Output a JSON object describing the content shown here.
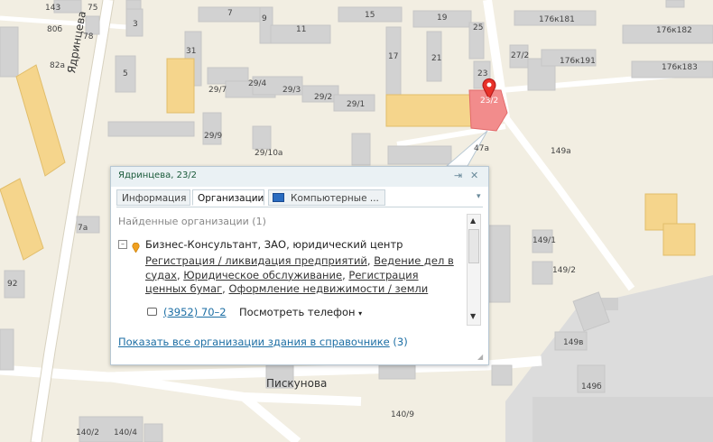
{
  "map": {
    "streets": [
      "Ядринцева",
      "Пискунова"
    ],
    "labels": [
      "143",
      "75",
      "80б",
      "78",
      "82а",
      "3",
      "5",
      "31",
      "7",
      "9",
      "15",
      "19",
      "25",
      "11",
      "17",
      "21",
      "23",
      "29/7",
      "29/4",
      "29/3",
      "29/2",
      "29/1",
      "29/9",
      "29/10а",
      "23/2",
      "47а",
      "176к181",
      "176к182",
      "27/2",
      "176к191",
      "176к183",
      "149а",
      "7а",
      "92",
      "149/1",
      "149/2",
      "149в",
      "149б",
      "140/9",
      "140/2",
      "140/4"
    ],
    "marker_color": "#e8322a"
  },
  "balloon": {
    "title": "Ядринцева, 23/2",
    "tabs": [
      "Информация",
      "Организации",
      "Компьютерные ..."
    ],
    "active_tab": "Организации",
    "found": "Найденные организации (1)",
    "org_toggle": "–",
    "org_name": "Бизнес-Консультант, ЗАО, юридический центр",
    "categories": [
      "Регистрация / ликвидация предприятий",
      "Ведение дел в судах",
      "Юридическое обслуживание",
      "Регистрация ценных бумаг",
      "Оформление недвижимости / земли"
    ],
    "phone": "(3952) 70–2",
    "show_phone": "Посмотреть телефон",
    "show_all_link": "Показать все организации здания в справочнике",
    "show_all_count": "(3)"
  }
}
